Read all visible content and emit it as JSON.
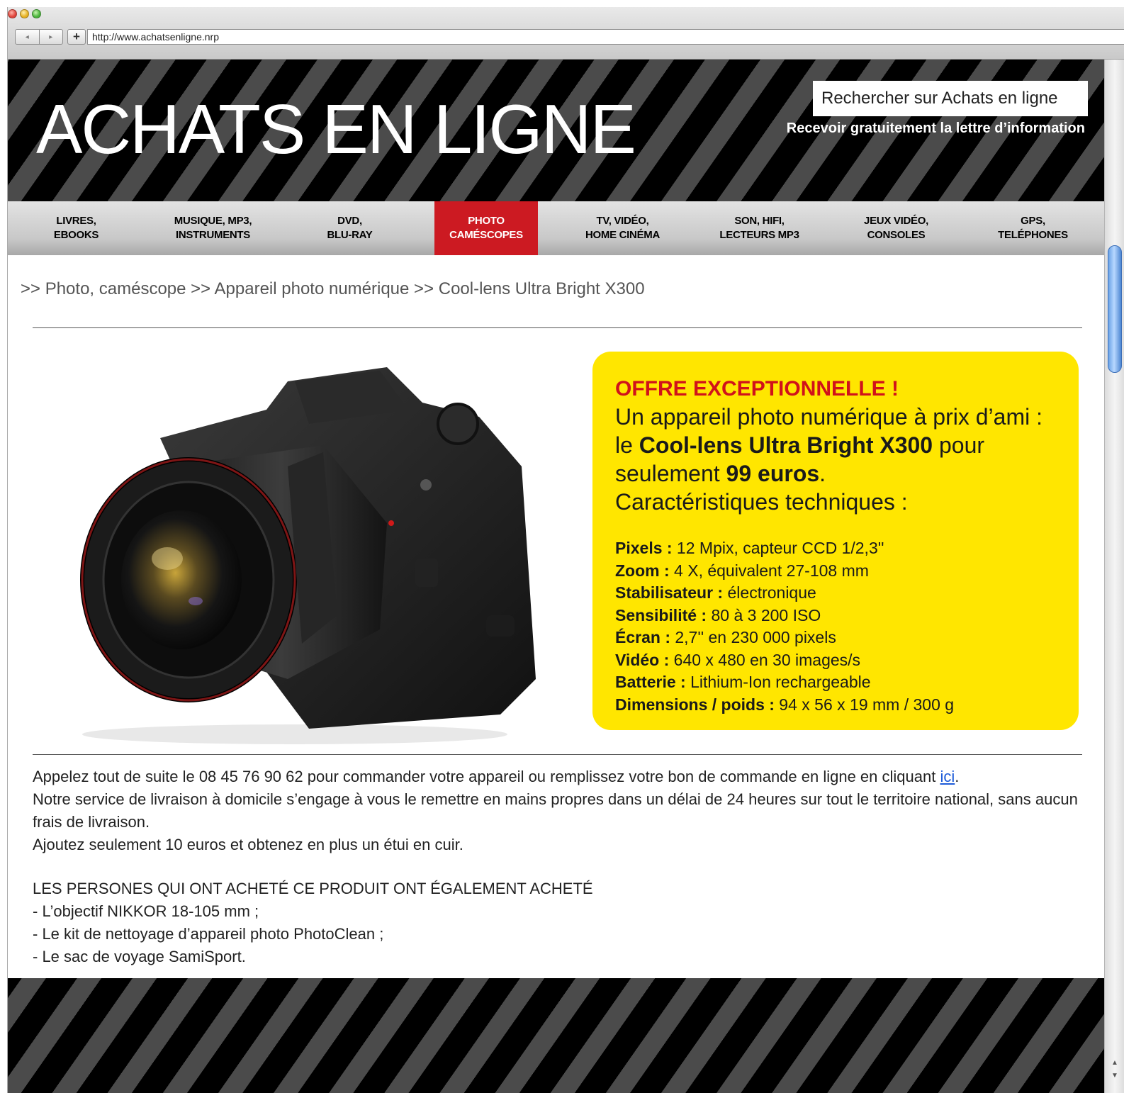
{
  "browser": {
    "url": "http://www.achatsenligne.nrp",
    "back_icon": "◂",
    "forward_icon": "▸",
    "add_icon": "+"
  },
  "header": {
    "logo": "ACHATS EN LIGNE",
    "search_placeholder": "Rechercher sur Achats en ligne",
    "newsletter": "Recevoir gratuitement la lettre d’information"
  },
  "menu": [
    {
      "line1": "LIVRES,",
      "line2": "EBOOKS"
    },
    {
      "line1": "MUSIQUE, MP3,",
      "line2": "INSTRUMENTS"
    },
    {
      "line1": "DVD,",
      "line2": "BLU-RAY"
    },
    {
      "line1": "PHOTO",
      "line2": "CAMÉSCOPES"
    },
    {
      "line1": "TV, VIDÉO,",
      "line2": "HOME CINÉMA"
    },
    {
      "line1": "SON, HIFI,",
      "line2": "LECTEURS MP3"
    },
    {
      "line1": "JEUX VIDÉO,",
      "line2": "CONSOLES"
    },
    {
      "line1": "GPS,",
      "line2": "TELÉPHONES"
    }
  ],
  "breadcrumb": ">> Photo, caméscope >> Appareil photo numérique >> Cool-lens Ultra Bright X300",
  "offer": {
    "title": "OFFRE EXCEPTIONNELLE !",
    "line1": "Un appareil photo numérique à prix d’ami :",
    "line2_pre": "le ",
    "product": "Cool-lens Ultra Bright X300",
    "line2_post": " pour",
    "line3_pre": "seulement ",
    "price": "99 euros",
    "line3_post": ".",
    "line4": "Caractéristiques techniques :",
    "specs": [
      {
        "label": "Pixels :",
        "value": " 12 Mpix, capteur CCD 1/2,3''"
      },
      {
        "label": "Zoom :",
        "value": " 4 X, équivalent 27-108 mm"
      },
      {
        "label": "Stabilisateur :",
        "value": " électronique"
      },
      {
        "label": "Sensibilité :",
        "value": " 80 à 3 200 ISO"
      },
      {
        "label": "Écran :",
        "value": " 2,7'' en 230 000 pixels"
      },
      {
        "label": "Vidéo :",
        "value": " 640 x 480 en 30 images/s"
      },
      {
        "label": "Batterie :",
        "value": " Lithium-Ion rechargeable"
      },
      {
        "label": "Dimensions / poids :",
        "value": " 94 x 56 x 19 mm / 300 g"
      }
    ]
  },
  "body": {
    "p1_pre": "Appelez tout de suite le 08 45 76 90 62 pour commander votre appareil ou remplissez votre bon de commande en ligne en cliquant ",
    "p1_link": "ici",
    "p1_post": ".",
    "p2": "Notre service de livraison à domicile s’engage à vous le remettre en mains propres dans un délai de 24 heures sur tout le territoire national, sans aucun frais de livraison.",
    "p3": "Ajoutez seulement 10 euros et obtenez en plus un étui en cuir."
  },
  "related": {
    "heading": "LES PERSONES QUI ONT ACHETÉ CE PRODUIT ONT ÉGALEMENT ACHETÉ",
    "items": [
      "- L’objectif NIKKOR 18-105 mm ;",
      "- Le kit de nettoyage d’appareil photo PhotoClean ;",
      "- Le sac de voyage SamiSport."
    ]
  },
  "colors": {
    "accent_red": "#cc1a22",
    "offer_yellow": "#ffe600",
    "link_blue": "#1d5bd8"
  }
}
